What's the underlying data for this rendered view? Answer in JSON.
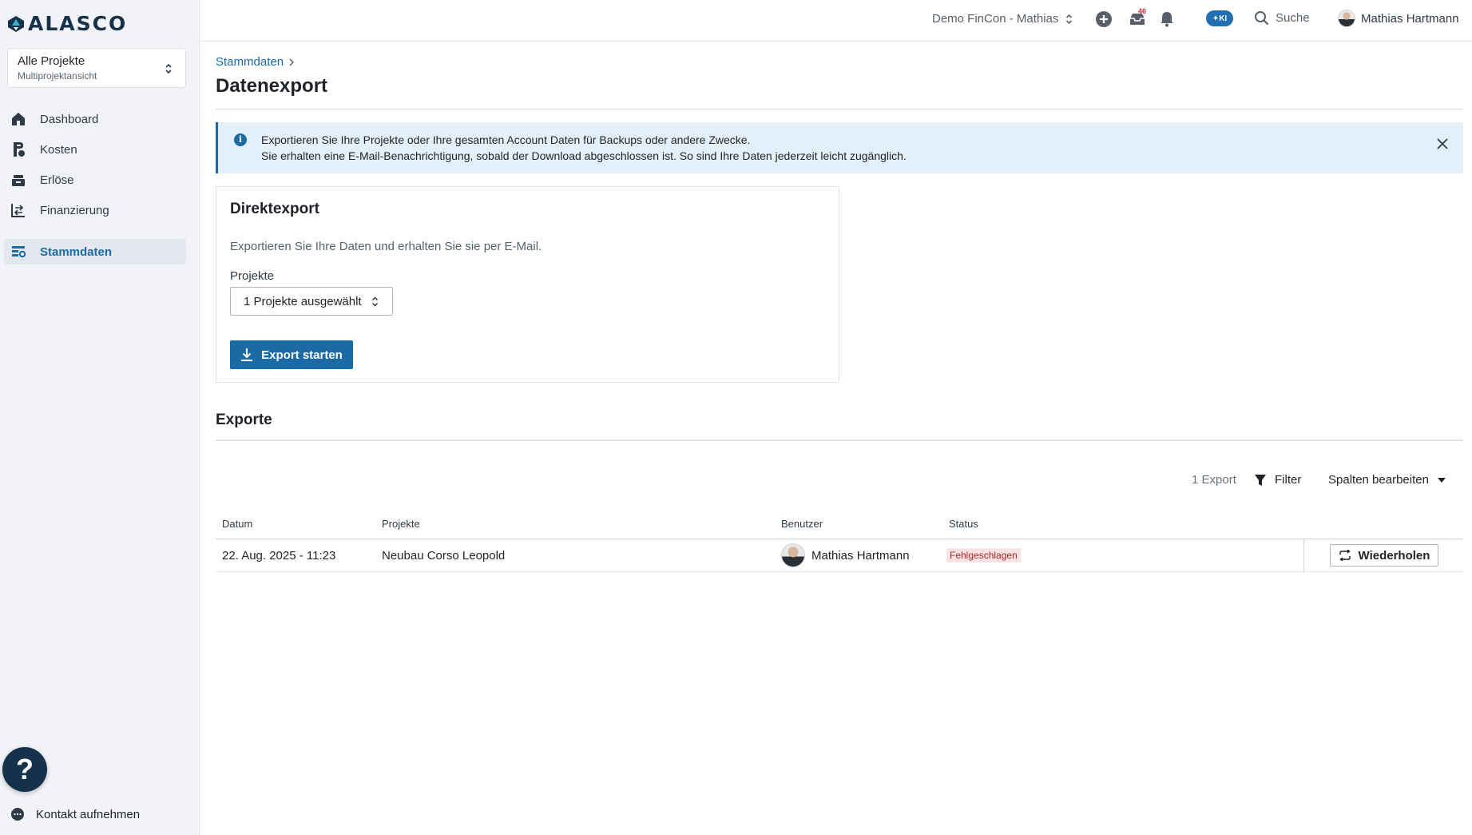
{
  "app": {
    "logo_text": "ALASCO"
  },
  "sidebar": {
    "project_select": {
      "title": "Alle Projekte",
      "subtitle": "Multiprojektansicht"
    },
    "items": [
      {
        "label": "Dashboard",
        "icon": "home-icon"
      },
      {
        "label": "Kosten",
        "icon": "costs-icon"
      },
      {
        "label": "Erlöse",
        "icon": "revenue-icon"
      },
      {
        "label": "Finanzierung",
        "icon": "financing-icon"
      },
      {
        "label": "Stammdaten",
        "icon": "master-data-icon",
        "active": true
      }
    ],
    "help_label": "?",
    "contact_label": "Kontakt aufnehmen"
  },
  "topbar": {
    "tenant": "Demo FinCon - Mathias",
    "inbox_count": "46",
    "ki_label": "KI",
    "search_label": "Suche",
    "user_name": "Mathias Hartmann"
  },
  "page": {
    "breadcrumb": "Stammdaten",
    "title": "Datenexport",
    "info": {
      "line1": "Exportieren Sie Ihre Projekte oder Ihre gesamten Account Daten für Backups oder andere Zwecke.",
      "line2": "Sie erhalten eine E-Mail-Benachrichtigung, sobald der Download abgeschlossen ist. So sind Ihre Daten jederzeit leicht zugänglich."
    },
    "direct_export": {
      "title": "Direktexport",
      "description": "Exportieren Sie Ihre Daten und erhalten Sie sie per E-Mail.",
      "field_label": "Projekte",
      "select_value": "1 Projekte ausgewählt",
      "button_label": "Export starten"
    },
    "exports": {
      "title": "Exporte",
      "count_label": "1 Export",
      "filter_label": "Filter",
      "columns_label": "Spalten bearbeiten",
      "headers": [
        "Datum",
        "Projekte",
        "Benutzer",
        "Status"
      ],
      "rows": [
        {
          "date": "22. Aug. 2025 - 11:23",
          "project": "Neubau Corso Leopold",
          "user": "Mathias Hartmann",
          "status": "Fehlgeschlagen",
          "action": "Wiederholen"
        }
      ]
    }
  },
  "colors": {
    "accent": "#1b6aa5",
    "sidebar_bg": "#f1f3f6",
    "info_bg": "#e3f0fa",
    "status_failed_bg": "#fbe3e3",
    "status_failed_text": "#a8242a",
    "help_button": "#14324b"
  }
}
